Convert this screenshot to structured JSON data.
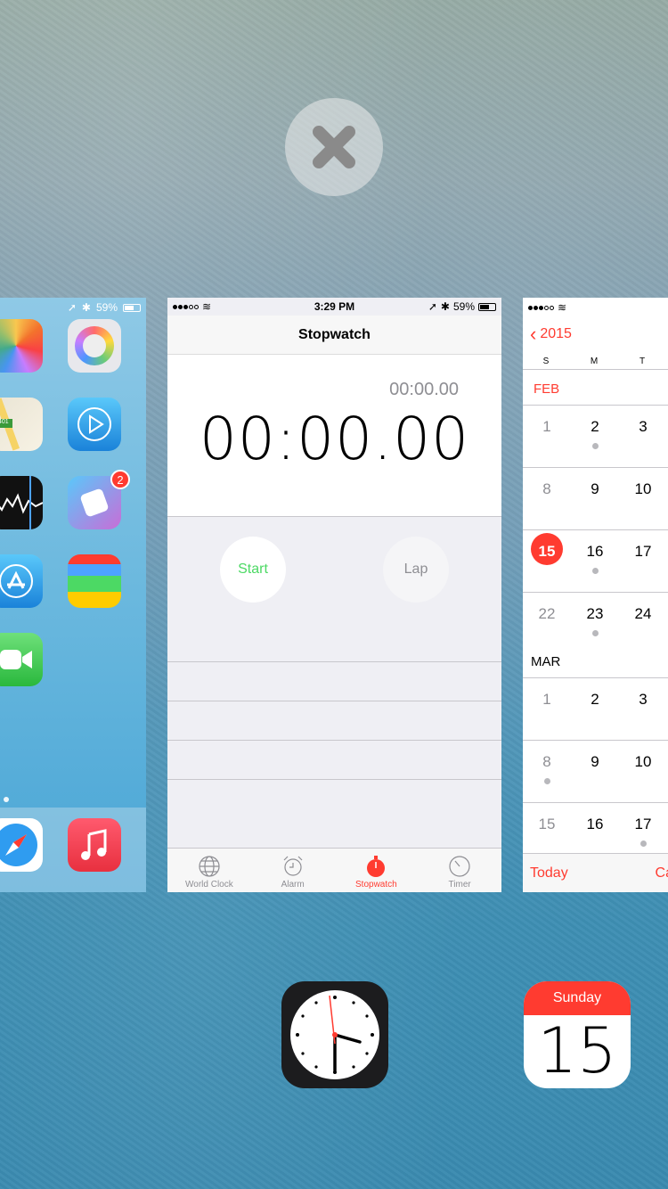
{
  "switcher": {
    "close_icon": "close-x-icon"
  },
  "home_card": {
    "battery": "59%",
    "apps": [
      {
        "name": "photos",
        "icon": "photos-icon"
      },
      {
        "name": "game-center",
        "icon": "game-center-icon"
      },
      {
        "name": "maps",
        "icon": "maps-icon"
      },
      {
        "name": "videos",
        "icon": "videos-icon"
      },
      {
        "name": "stocks",
        "icon": "stocks-icon"
      },
      {
        "name": "game",
        "icon": "dice-icon",
        "badge": "2"
      },
      {
        "name": "app-store",
        "icon": "app-store-icon"
      },
      {
        "name": "passbook",
        "icon": "passbook-icon"
      },
      {
        "name": "facetime",
        "icon": "facetime-icon"
      }
    ],
    "dock": [
      {
        "name": "safari",
        "icon": "safari-icon"
      },
      {
        "name": "music",
        "icon": "music-icon"
      }
    ]
  },
  "stopwatch": {
    "status": {
      "time": "3:29 PM",
      "battery": "59%"
    },
    "title": "Stopwatch",
    "lap_time": "00:00.00",
    "main_time": "00:00.00",
    "start_label": "Start",
    "lap_label": "Lap",
    "tabs": [
      {
        "label": "World Clock",
        "icon": "globe-icon"
      },
      {
        "label": "Alarm",
        "icon": "alarm-icon"
      },
      {
        "label": "Stopwatch",
        "icon": "stopwatch-icon",
        "active": true
      },
      {
        "label": "Timer",
        "icon": "timer-icon"
      }
    ],
    "colors": {
      "start": "#4cd964",
      "active_tab": "#ff3b30"
    }
  },
  "calendar": {
    "back_label": "2015",
    "weekdays": [
      "S",
      "M",
      "T"
    ],
    "months": {
      "feb": "FEB",
      "mar": "MAR"
    },
    "weeks": [
      {
        "days": [
          "1",
          "2",
          "3"
        ],
        "dots": [
          false,
          true,
          false
        ]
      },
      {
        "days": [
          "8",
          "9",
          "10"
        ],
        "dots": [
          false,
          false,
          false
        ]
      },
      {
        "days": [
          "15",
          "16",
          "17"
        ],
        "dots": [
          false,
          true,
          false
        ],
        "today": 0
      },
      {
        "days": [
          "22",
          "23",
          "24"
        ],
        "dots": [
          false,
          true,
          false
        ]
      },
      {
        "days": [
          "1",
          "2",
          "3"
        ],
        "dots": [
          false,
          false,
          false
        ]
      },
      {
        "days": [
          "8",
          "9",
          "10"
        ],
        "dots": [
          true,
          false,
          false
        ]
      },
      {
        "days": [
          "15",
          "16",
          "17"
        ],
        "dots": [
          false,
          false,
          true
        ]
      }
    ],
    "footer_today": "Today",
    "footer_right": "Ca"
  },
  "bottom_icons": {
    "clock": {
      "icon": "clock-app-icon"
    },
    "calendar": {
      "day": "Sunday",
      "date": "15"
    }
  }
}
